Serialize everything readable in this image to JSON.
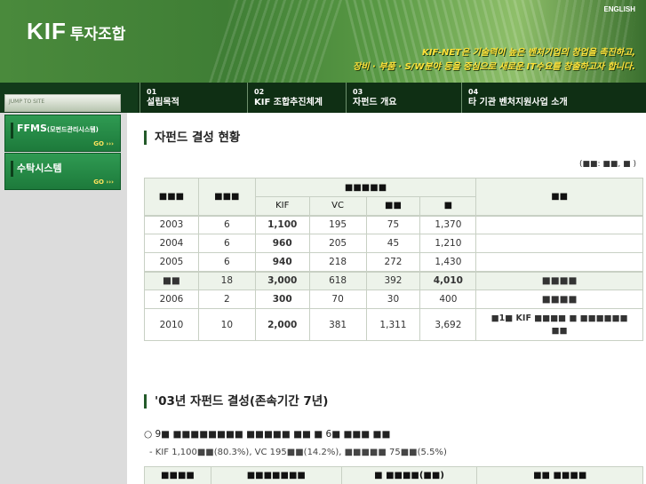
{
  "header": {
    "logo_mark": "KIF",
    "logo_text": "투자조합",
    "english_link": "ENGLISH",
    "slogan_line1": "KIF-NET은 기술력이 높은 벤처기업의 창업을 촉진하고,",
    "slogan_line2": "장비 · 부품 · S/W분야 등을 중심으로 새로운 IT수요를 창출하고자 합니다."
  },
  "nav": {
    "items": [
      {
        "num": "01",
        "label": "설립목적"
      },
      {
        "num": "02",
        "label": "KIF 조합추진체계"
      },
      {
        "num": "03",
        "label": "자펀드 개요"
      },
      {
        "num": "04",
        "label": "타 기관 벤처지원사업 소개"
      }
    ]
  },
  "sidebar": {
    "jump_label": "JUMP TO SITE",
    "buttons": [
      {
        "title": "FFMS",
        "sub": "(모펀드관리시스템)",
        "go": "GO ›››"
      },
      {
        "title": "수탁시스템",
        "sub": "",
        "go": "GO ›››"
      }
    ]
  },
  "main": {
    "section1_title": "자펀드 결성 현황",
    "unit_note": "(■■: ■■, ■ )",
    "table1": {
      "head": {
        "year": "■■■",
        "count": "■■■",
        "group": "■■■■■",
        "kif": "KIF",
        "vc": "VC",
        "col3": "■■",
        "col4": "■",
        "note": "■■"
      },
      "rows": [
        {
          "year": "2003",
          "count": "6",
          "kif": "1,100",
          "vc": "195",
          "c3": "75",
          "c4": "1,370",
          "note": ""
        },
        {
          "year": "2004",
          "count": "6",
          "kif": "960",
          "vc": "205",
          "c3": "45",
          "c4": "1,210",
          "note": ""
        },
        {
          "year": "2005",
          "count": "6",
          "kif": "940",
          "vc": "218",
          "c3": "272",
          "c4": "1,430",
          "note": ""
        }
      ],
      "total": {
        "year": "■■",
        "count": "18",
        "kif": "3,000",
        "vc": "618",
        "c3": "392",
        "c4": "4,010",
        "note": "■■■■"
      },
      "rows2": [
        {
          "year": "2006",
          "count": "2",
          "kif": "300",
          "vc": "70",
          "c3": "30",
          "c4": "400",
          "note": "■■■■"
        },
        {
          "year": "2010",
          "count": "10",
          "kif": "2,000",
          "vc": "381",
          "c3": "1,311",
          "c4": "3,692",
          "note": "■1■ KIF ■■■■ ■ ■■■■■■ ■■"
        }
      ]
    },
    "section2_title": "'03년 자펀드 결성(존속기간 7년)",
    "para1": "○ 9■ ■■■■■■■■ ■■■■■ ■■ ■ 6■ ■■■ ■■",
    "para2": "- KIF 1,100■■(80.3%), VC 195■■(14.2%), ■■■■■ 75■■(5.5%)",
    "table2": {
      "head": [
        "■■■■",
        "■■■■■■■",
        "■ ■■■■(■■)",
        "■■ ■■■■"
      ]
    }
  }
}
